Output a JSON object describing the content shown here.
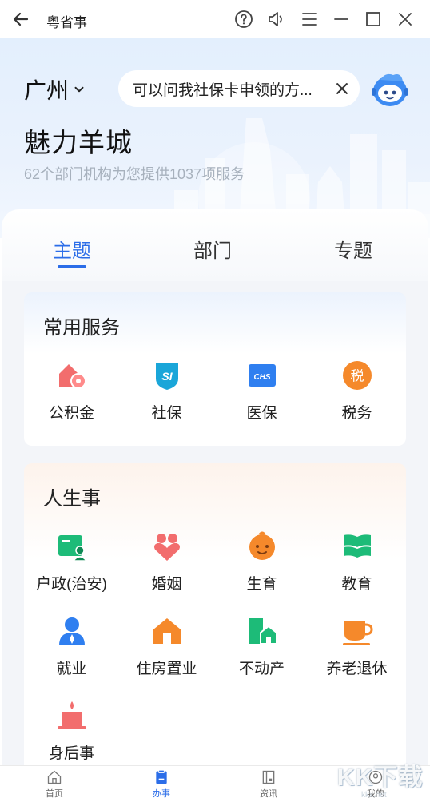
{
  "app": {
    "title": "粤省事"
  },
  "hero": {
    "city": "广州",
    "search_placeholder": "可以问我社保卡申领的方...",
    "title": "魅力羊城",
    "subtitle": "62个部门机构为您提供1037项服务"
  },
  "tabs": [
    {
      "label": "主题",
      "active": true
    },
    {
      "label": "部门",
      "active": false
    },
    {
      "label": "专题",
      "active": false
    }
  ],
  "common_services": {
    "title": "常用服务",
    "items": [
      {
        "label": "公积金",
        "icon": "housing-fund-icon"
      },
      {
        "label": "社保",
        "icon": "social-security-icon"
      },
      {
        "label": "医保",
        "icon": "medical-insurance-icon"
      },
      {
        "label": "税务",
        "icon": "tax-icon",
        "icon_text": "税"
      }
    ]
  },
  "life_events": {
    "title": "人生事",
    "items": [
      {
        "label": "户政(治安)",
        "icon": "household-icon"
      },
      {
        "label": "婚姻",
        "icon": "marriage-icon"
      },
      {
        "label": "生育",
        "icon": "birth-icon"
      },
      {
        "label": "教育",
        "icon": "education-icon"
      },
      {
        "label": "就业",
        "icon": "employment-icon"
      },
      {
        "label": "住房置业",
        "icon": "housing-icon"
      },
      {
        "label": "不动产",
        "icon": "real-estate-icon"
      },
      {
        "label": "养老退休",
        "icon": "retirement-icon"
      },
      {
        "label": "身后事",
        "icon": "funeral-icon"
      }
    ]
  },
  "bottom_nav": [
    {
      "label": "首页",
      "icon": "home-icon",
      "active": false
    },
    {
      "label": "办事",
      "icon": "services-icon",
      "active": true
    },
    {
      "label": "资讯",
      "icon": "news-icon",
      "active": false
    },
    {
      "label": "我的",
      "icon": "profile-icon",
      "active": false
    }
  ],
  "watermark": {
    "text": "KK下载",
    "url": "kkx.net"
  },
  "colors": {
    "accent": "#2b6de8",
    "hero_bg": "#e3effd"
  }
}
